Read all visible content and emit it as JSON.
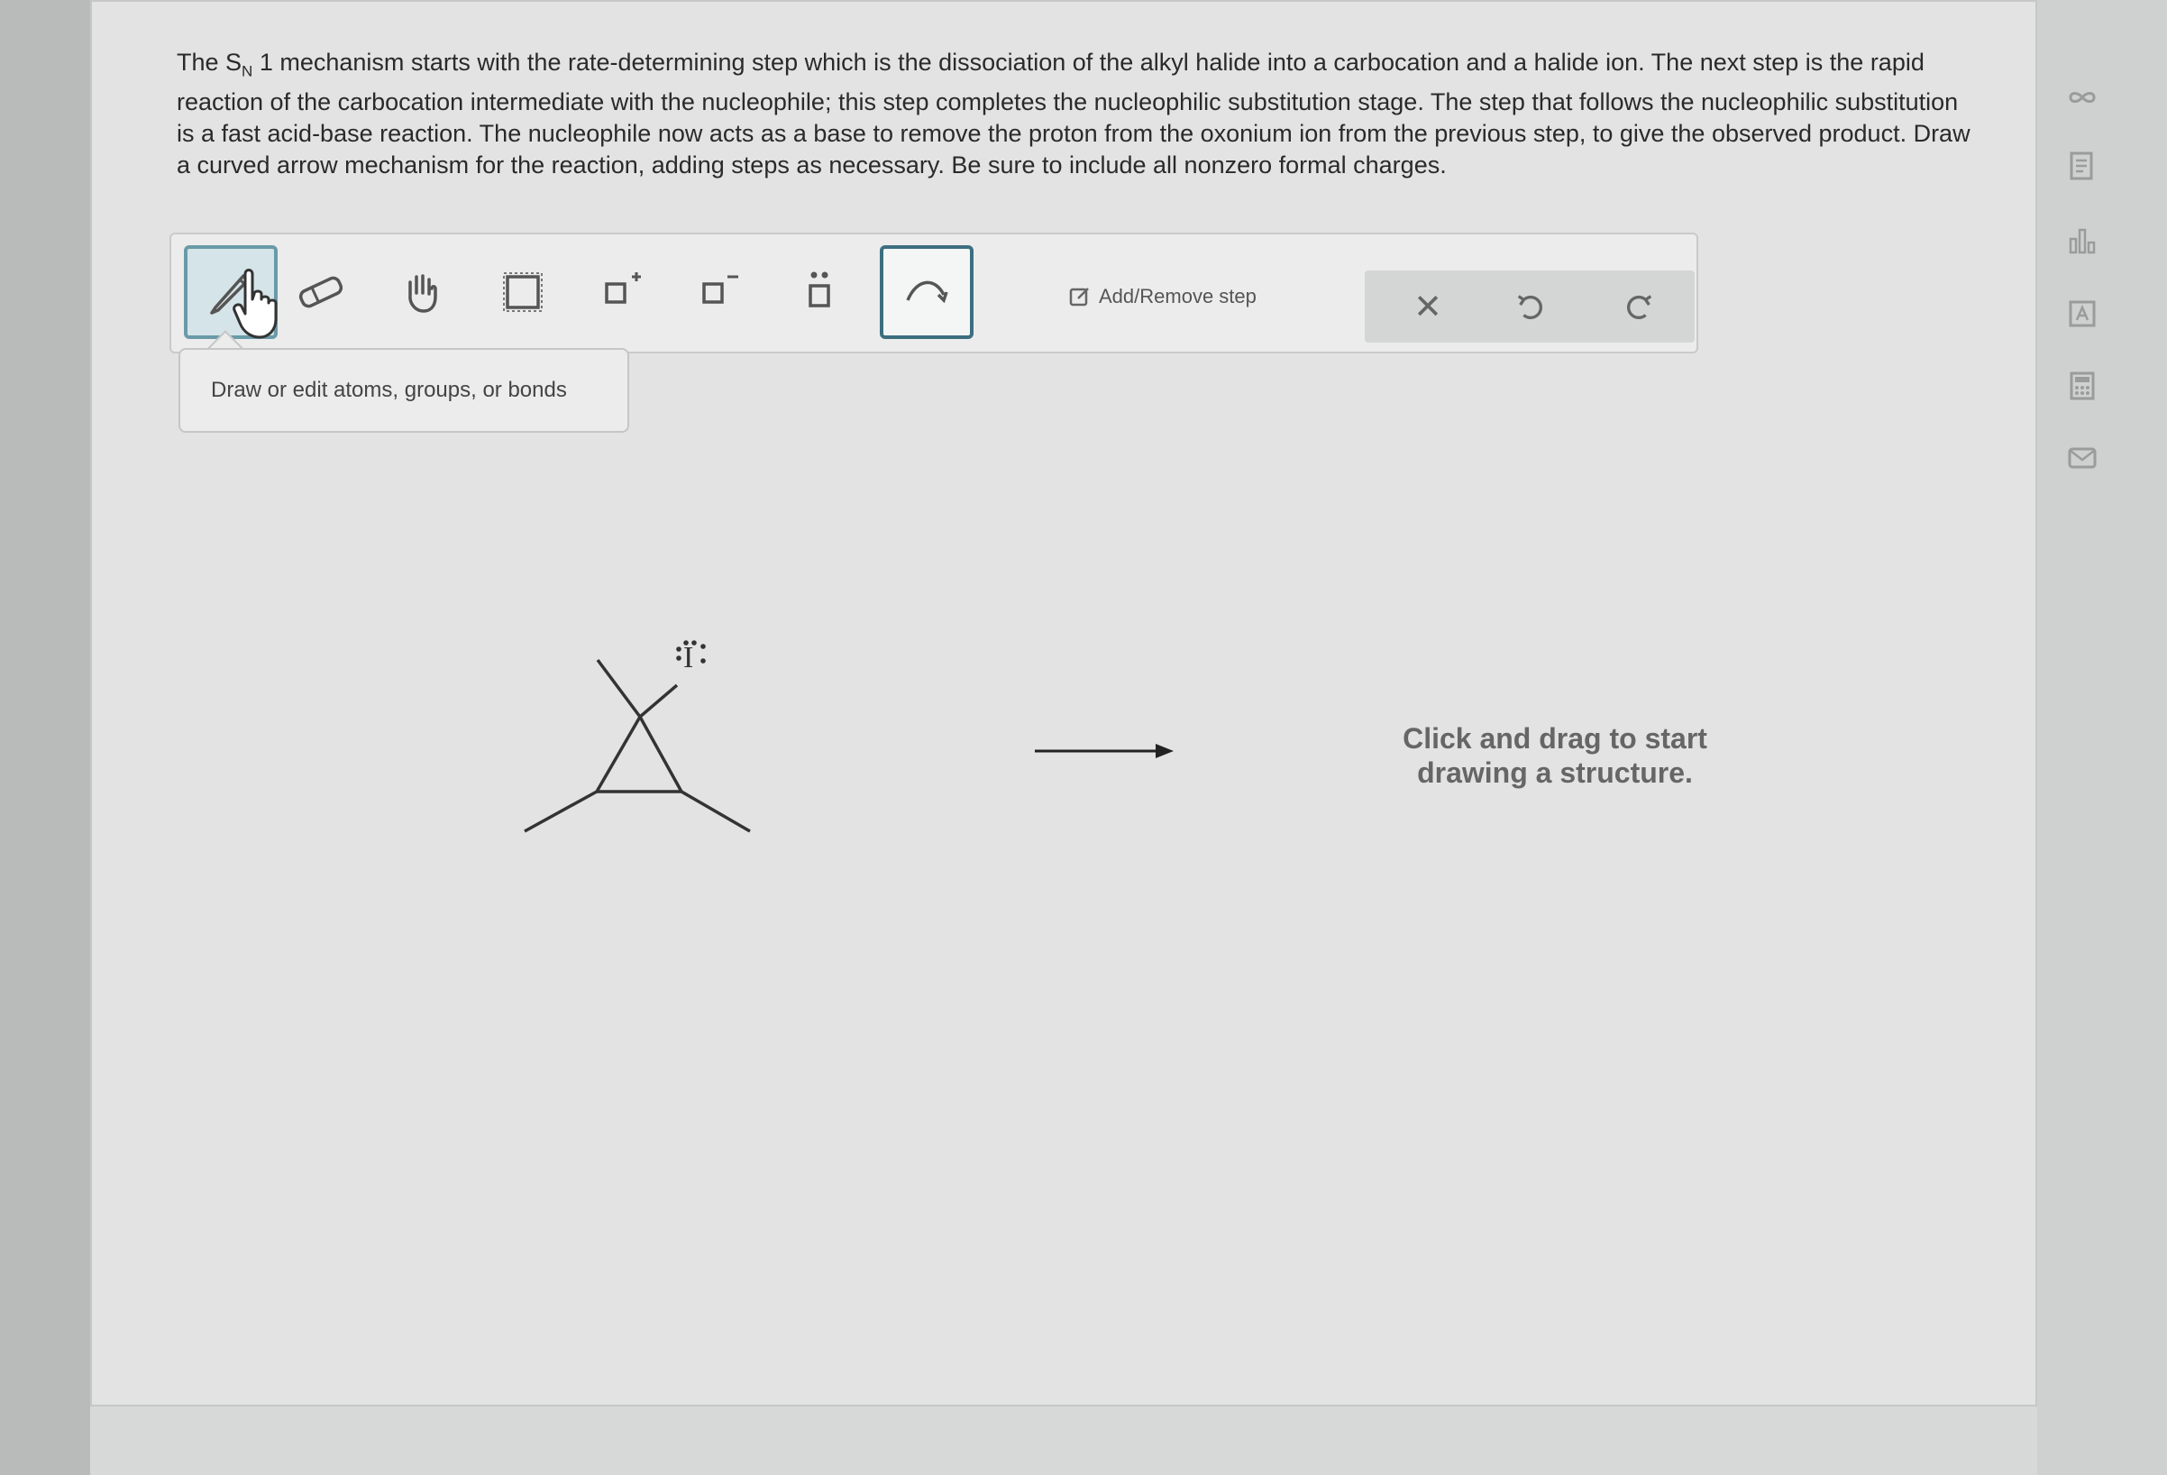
{
  "question": {
    "prefix": "The S",
    "subscript": "N",
    "body": " 1 mechanism starts with the rate-determining step which is the dissociation of the alkyl halide into a carbocation and a halide ion. The next step is the rapid reaction of the carbocation intermediate with the nucleophile; this step completes the nucleophilic substitution stage. The step that follows the nucleophilic substitution is a fast acid-base reaction. The nucleophile now acts as a base to remove the proton from the oxonium ion from the previous step, to give the observed product. Draw a curved arrow mechanism for the reaction, adding steps as necessary. Be sure to include all nonzero formal charges."
  },
  "toolbar": {
    "tools": [
      {
        "name": "draw-tool",
        "icon": "pencil-icon",
        "active": true
      },
      {
        "name": "erase-tool",
        "icon": "eraser-icon"
      },
      {
        "name": "move-tool",
        "icon": "hand-icon"
      },
      {
        "name": "select-tool",
        "icon": "selection-box-icon"
      },
      {
        "name": "positive-charge-tool",
        "icon": "positive-charge-icon",
        "glyph": "+"
      },
      {
        "name": "negative-charge-tool",
        "icon": "negative-charge-icon",
        "glyph": "−"
      },
      {
        "name": "lone-pair-tool",
        "icon": "lone-pair-icon"
      },
      {
        "name": "curved-arrow-tool",
        "icon": "curved-arrow-icon",
        "selected": true
      }
    ],
    "add_remove_label": "Add/Remove step",
    "actions": {
      "clear": "✕",
      "undo": "undo-icon",
      "redo": "redo-icon"
    }
  },
  "tooltip": {
    "text": "Draw or edit atoms, groups, or bonds"
  },
  "canvas": {
    "reactant_atom_label": "I",
    "placeholder_line1": "Click and drag to start",
    "placeholder_line2": "drawing a structure."
  },
  "sidebar": {
    "icons": [
      "infinity-icon",
      "document-icon",
      "bar-chart-icon",
      "periodic-table-icon",
      "calculator-icon",
      "mail-icon"
    ]
  },
  "colors": {
    "accent": "#3c6e80",
    "active_tool_bg": "#d5e4e8",
    "panel": "#e2e3e2",
    "text": "#2a2a2a"
  }
}
